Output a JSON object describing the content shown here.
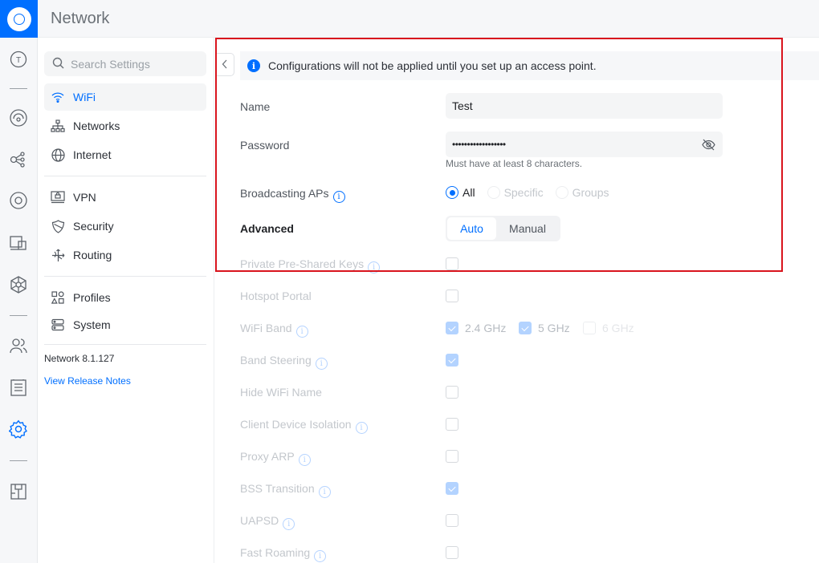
{
  "app": {
    "title": "Network"
  },
  "rail": {
    "icons": [
      "logo-icon",
      "topology-icon",
      "dashboard-icon",
      "devices-icon",
      "clients-icon",
      "insights-icon",
      "integrations-icon",
      "users-icon",
      "logs-icon",
      "settings-icon",
      "innerspace-icon"
    ]
  },
  "sidebar": {
    "search_placeholder": "Search Settings",
    "items": [
      {
        "label": "WiFi",
        "icon": "wifi-icon",
        "active": true
      },
      {
        "label": "Networks",
        "icon": "network-tree-icon"
      },
      {
        "label": "Internet",
        "icon": "globe-icon"
      },
      {
        "label": "VPN",
        "icon": "vpn-icon"
      },
      {
        "label": "Security",
        "icon": "shield-icon"
      },
      {
        "label": "Routing",
        "icon": "routing-icon"
      },
      {
        "label": "Profiles",
        "icon": "profiles-icon"
      },
      {
        "label": "System",
        "icon": "system-icon"
      }
    ],
    "version": "Network 8.1.127",
    "release_notes": "View Release Notes"
  },
  "banner": {
    "text": "Configurations will not be applied until you set up an access point."
  },
  "form": {
    "name_label": "Name",
    "name_value": "Test",
    "password_label": "Password",
    "password_value": "••••••••••••••••••",
    "password_hint": "Must have at least 8 characters.",
    "broadcasting_label": "Broadcasting APs",
    "broadcasting_options": [
      "All",
      "Specific",
      "Groups"
    ],
    "broadcasting_selected": "All",
    "advanced_label": "Advanced",
    "advanced_options": [
      "Auto",
      "Manual"
    ],
    "advanced_selected": "Auto",
    "ppsk_label": "Private Pre-Shared Keys",
    "hotspot_label": "Hotspot Portal",
    "wifiband_label": "WiFi Band",
    "bands": [
      {
        "label": "2.4 GHz",
        "checked": true
      },
      {
        "label": "5 GHz",
        "checked": true
      },
      {
        "label": "6 GHz",
        "checked": false
      }
    ],
    "band_steering_label": "Band Steering",
    "hide_name_label": "Hide WiFi Name",
    "isolation_label": "Client Device Isolation",
    "proxy_arp_label": "Proxy ARP",
    "bss_label": "BSS Transition",
    "uapsd_label": "UAPSD",
    "fast_roaming_label": "Fast Roaming"
  },
  "colors": {
    "accent": "#006fff",
    "highlight": "#d9141d"
  }
}
